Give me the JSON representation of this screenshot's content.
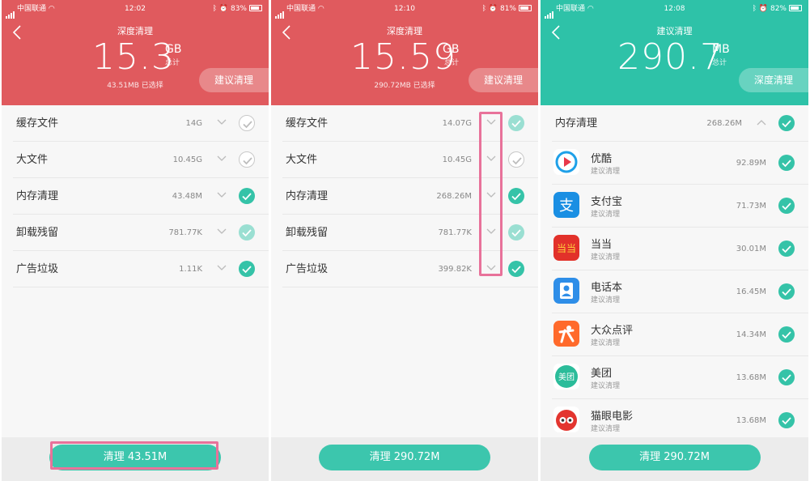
{
  "colors": {
    "red_header": "#e05a5e",
    "teal_header": "#2ec2a8",
    "check_green": "#35c3a8",
    "button_green": "#3cc6ad",
    "highlight_pink": "#e8729a"
  },
  "screens": [
    {
      "status": {
        "carrier": "中国联通",
        "time": "12:02",
        "battery": "83%",
        "battery_level": 0.83
      },
      "title": "深度清理",
      "total": "15.3",
      "unit": "GB",
      "unit_sub": "总计",
      "selected": "43.51MB 已选择",
      "pill": "建议清理",
      "rows": [
        {
          "label": "缓存文件",
          "size": "14G",
          "check": "empty"
        },
        {
          "label": "大文件",
          "size": "10.45G",
          "check": "empty"
        },
        {
          "label": "内存清理",
          "size": "43.48M",
          "check": "full"
        },
        {
          "label": "卸载残留",
          "size": "781.77K",
          "check": "light"
        },
        {
          "label": "广告垃圾",
          "size": "1.11K",
          "check": "full"
        }
      ],
      "button": "清理 43.51M"
    },
    {
      "status": {
        "carrier": "中国联通",
        "time": "12:10",
        "battery": "81%",
        "battery_level": 0.81
      },
      "title": "深度清理",
      "total": "15.59",
      "unit": "GB",
      "unit_sub": "总计",
      "selected": "290.72MB 已选择",
      "pill": "建议清理",
      "rows": [
        {
          "label": "缓存文件",
          "size": "14.07G",
          "check": "light"
        },
        {
          "label": "大文件",
          "size": "10.45G",
          "check": "empty"
        },
        {
          "label": "内存清理",
          "size": "268.26M",
          "check": "full"
        },
        {
          "label": "卸载残留",
          "size": "781.77K",
          "check": "light"
        },
        {
          "label": "广告垃圾",
          "size": "399.82K",
          "check": "full"
        }
      ],
      "button": "清理 290.72M"
    },
    {
      "status": {
        "carrier": "中国联通",
        "time": "12:08",
        "battery": "82%",
        "battery_level": 0.82
      },
      "title": "建议清理",
      "total": "290.7",
      "unit": "MB",
      "unit_sub": "总计",
      "pill": "深度清理",
      "section": {
        "label": "内存清理",
        "size": "268.26M"
      },
      "apps": [
        {
          "name": "优酷",
          "sub": "建议清理",
          "size": "92.89M",
          "icon": "youku-icon"
        },
        {
          "name": "支付宝",
          "sub": "建议清理",
          "size": "71.73M",
          "icon": "alipay-icon"
        },
        {
          "name": "当当",
          "sub": "建议清理",
          "size": "30.01M",
          "icon": "dangdang-icon"
        },
        {
          "name": "电话本",
          "sub": "建议清理",
          "size": "16.45M",
          "icon": "contacts-icon"
        },
        {
          "name": "大众点评",
          "sub": "建议清理",
          "size": "14.34M",
          "icon": "dianping-icon"
        },
        {
          "name": "美团",
          "sub": "建议清理",
          "size": "13.68M",
          "icon": "meituan-icon"
        },
        {
          "name": "猫眼电影",
          "sub": "建议清理",
          "size": "13.68M",
          "icon": "maoyan-icon"
        }
      ],
      "button": "清理 290.72M"
    }
  ]
}
